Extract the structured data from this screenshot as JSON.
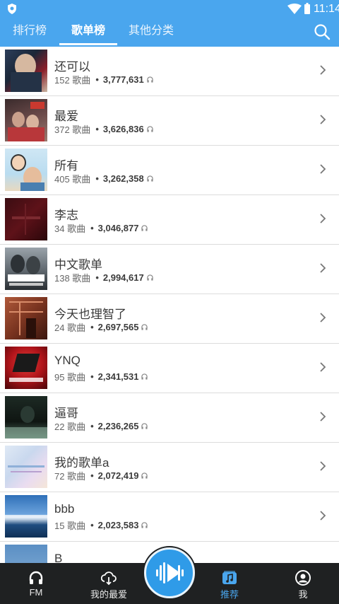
{
  "status_bar": {
    "time": "11:14"
  },
  "tabs": [
    {
      "label": "排行榜",
      "active": false
    },
    {
      "label": "歌单榜",
      "active": true
    },
    {
      "label": "其他分类",
      "active": false
    }
  ],
  "playlists": [
    {
      "title": "还可以",
      "count": "152 歌曲",
      "plays": "3,777,631"
    },
    {
      "title": "最爱",
      "count": "372 歌曲",
      "plays": "3,626,836"
    },
    {
      "title": "所有",
      "count": "405 歌曲",
      "plays": "3,262,358"
    },
    {
      "title": "李志",
      "count": "34 歌曲",
      "plays": "3,046,877"
    },
    {
      "title": "中文歌单",
      "count": "138 歌曲",
      "plays": "2,994,617"
    },
    {
      "title": "今天也理智了",
      "count": "24 歌曲",
      "plays": "2,697,565"
    },
    {
      "title": "YNQ",
      "count": "95 歌曲",
      "plays": "2,341,531"
    },
    {
      "title": "逼哥",
      "count": "22 歌曲",
      "plays": "2,236,265"
    },
    {
      "title": "我的歌单a",
      "count": "72 歌曲",
      "plays": "2,072,419"
    },
    {
      "title": "bbb",
      "count": "15 歌曲",
      "plays": "2,023,583"
    },
    {
      "title": "B",
      "count": "",
      "plays": ""
    }
  ],
  "bottom_nav": {
    "fm": "FM",
    "favorites": "我的最爱",
    "recommend": "推荐",
    "me": "我"
  },
  "colors": {
    "accent": "#4aa6ee",
    "nav_bg": "#1f2122"
  }
}
